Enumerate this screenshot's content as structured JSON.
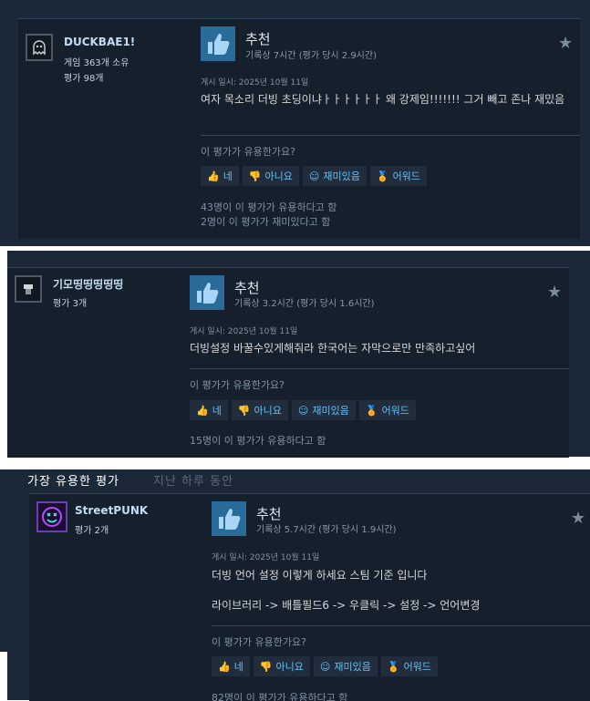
{
  "common": {
    "recommended": "추천",
    "helpful_q": "이 평가가 유용한가요?",
    "yes": "네",
    "no": "아니요",
    "funny": "재미있음",
    "award": "어워드"
  },
  "colors": {
    "panel_bg": "#1b2838",
    "review_bg": "#16202d",
    "accent": "#66c0f4",
    "thumb_bg": "#2a6c99",
    "award_gold": "#e6b71e"
  },
  "section": {
    "title": "가장 유용한 평가",
    "subtitle": "지난 하루 동안"
  },
  "reviews": [
    {
      "author": "DUCKBAE1!",
      "games_owned": "게임 363개 소유",
      "review_count": "평가 98개",
      "hours": "기록상 7시간 (평가 당시 2.9시간)",
      "posted": "게시 일시: 2025년 10월 11일",
      "text": "여자 목소리 더빙 초딩이냐ㅏㅏㅏㅏㅏㅏ 왜 강제임!!!!!!! 그거 빼고 존나 재밌음",
      "helpful_count": "43명이 이 평가가 유용하다고 함",
      "funny_count": "2명이 이 평가가 재미있다고 함",
      "avatar_icon": "ghost-icon"
    },
    {
      "author": "기모띵띵띵띵띵",
      "review_count": "평가 3개",
      "hours": "기록상 3.2시간 (평가 당시 1.6시간)",
      "posted": "게시 일시: 2025년 10월 11일",
      "text": "더빙설정 바꿀수있게해줘라 한국어는 자막으로만 만족하고싶어",
      "helpful_count": "15명이 이 평가가 유용하다고 함",
      "avatar_icon": "figure-icon"
    },
    {
      "author": "StreetPUNK",
      "review_count": "평가 2개",
      "hours": "기록상 5.7시간 (평가 당시 1.9시간)",
      "posted": "게시 일시: 2025년 10월 11일",
      "text": "더빙 언어 설정 이렇게 하세요 스팀 기준 입니다",
      "text2": "라이브러리 -> 배틀필드6 -> 우클릭 -> 설정 -> 언어변경",
      "helpful_count": "82명이 이 평가가 유용하다고 함",
      "avatar_icon": "neon-smiley-icon"
    }
  ]
}
